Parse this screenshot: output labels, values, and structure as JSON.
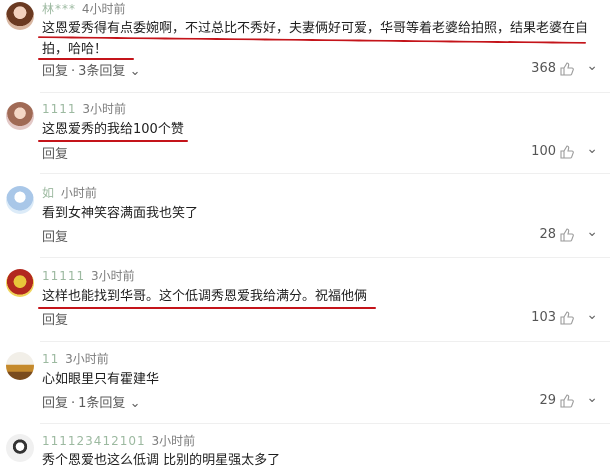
{
  "comments": [
    {
      "username": "林***",
      "time": "4小时前",
      "lines": [
        "这恩爱秀得有点委婉啊，不过总比不秀好，夫妻俩好可爱，华哥等着老婆给拍照，结果老婆在自",
        "拍，哈哈！"
      ],
      "reply_label": "回复",
      "sub_replies_label": "3条回复",
      "likes": "368"
    },
    {
      "username": "1111",
      "time": "3小时前",
      "lines": [
        "这恩爱秀的我给100个赞"
      ],
      "reply_label": "回复",
      "likes": "100"
    },
    {
      "username": "如",
      "time": "小时前",
      "lines": [
        "看到女神笑容满面我也笑了"
      ],
      "reply_label": "回复",
      "likes": "28"
    },
    {
      "username": "11111",
      "time": "3小时前",
      "lines": [
        "这样也能找到华哥。这个低调秀恩爱我给满分。祝福他俩"
      ],
      "reply_label": "回复",
      "likes": "103"
    },
    {
      "username": "11",
      "time": "3小时前",
      "lines": [
        "心如眼里只有霍建华"
      ],
      "reply_label": "回复",
      "sub_replies_label": "1条回复",
      "likes": "29"
    },
    {
      "username": "111123412101",
      "time": "3小时前",
      "lines": [
        "秀个恩爱也这么低调 比别的明星强太多了"
      ]
    }
  ],
  "icons": {
    "expand": "chevron-down-icon",
    "like": "thumbs-up-icon",
    "more": "chevron-down-icon"
  },
  "colors": {
    "underline": "#c4141a",
    "meta_text": "#7c7c7c",
    "username": "#9cb9a0"
  }
}
